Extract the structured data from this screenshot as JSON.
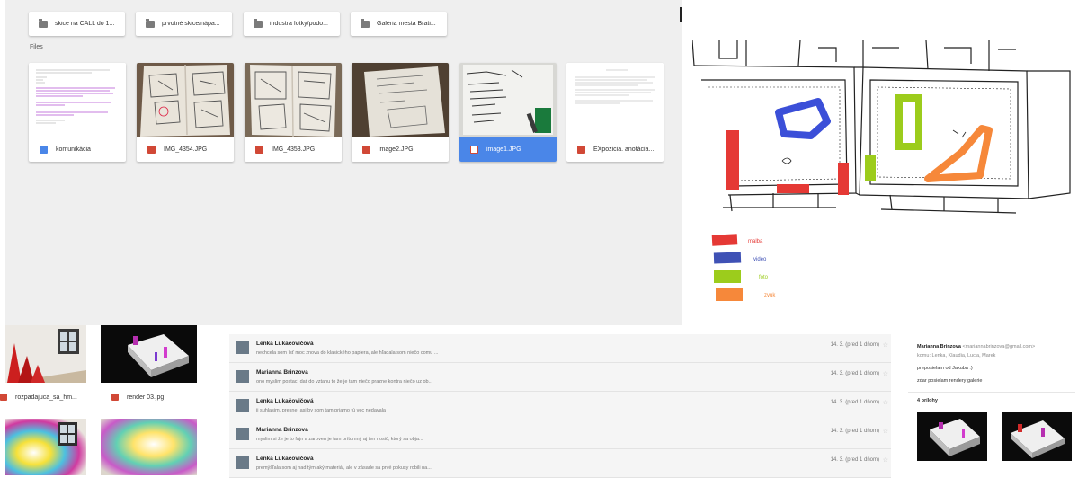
{
  "drive": {
    "folders": [
      {
        "label": "skice na CALL do 1..."
      },
      {
        "label": "prvotné skice/nápa..."
      },
      {
        "label": "industra fotky/podo..."
      },
      {
        "label": "Galéria mesta Brati..."
      }
    ],
    "files_label": "Files",
    "files": [
      {
        "name": "komunikácia",
        "type": "doc",
        "selected": false
      },
      {
        "name": "IMG_4354.JPG",
        "type": "img",
        "selected": false
      },
      {
        "name": "IMG_4353.JPG",
        "type": "img",
        "selected": false
      },
      {
        "name": "image2.JPG",
        "type": "img",
        "selected": false
      },
      {
        "name": "image1.JPG",
        "type": "img",
        "selected": true
      },
      {
        "name": "EXpozicia. anotácia...",
        "type": "pdf",
        "selected": false
      }
    ]
  },
  "floorplan": {
    "legend": [
      {
        "label": "malba",
        "color": "#e53935"
      },
      {
        "label": "video",
        "color": "#3f51b5"
      },
      {
        "label": "foto",
        "color": "#9ccc1c"
      },
      {
        "label": "zvuk",
        "color": "#f6883a"
      }
    ]
  },
  "renders": {
    "captions": [
      "rozpadajuca_sa_hm...",
      "render 03.jpg"
    ]
  },
  "emails": [
    {
      "sender": "Lenka Lukačovičová",
      "snippet": "nechcela som ísť moc znova do klasického papiera, ale hľadala som niečo comu ...",
      "date": "14. 3. (pred 1 dňom)"
    },
    {
      "sender": "Marianna Brinzova",
      "snippet": "ono myslim postací dať do vztahu to že je tam niečo prazne kontra niečo uz ob...",
      "date": "14. 3. (pred 1 dňom)"
    },
    {
      "sender": "Lenka Lukačovičová",
      "snippet": "jj suhlasim, presne, asi by som tam priamo tú vec nedavala",
      "date": "14. 3. (pred 1 dňom)"
    },
    {
      "sender": "Marianna Brinzova",
      "snippet": "myslim si že je to fajn a zaroven je tam prítomný aj ten nosič, ktorý sa obja...",
      "date": "14. 3. (pred 1 dňom)"
    },
    {
      "sender": "Lenka Lukačovičová",
      "snippet": "premýšľala som aj nad tým aký materiál, ale v zásade sa prvé pokusy robili na...",
      "date": "14. 3. (pred 1 dňom)"
    }
  ],
  "detail": {
    "from_name": "Marianna Brinzova",
    "from_email": "<mariannabrinzova@gmail.com>",
    "to": "komu: Lenka, Klaudia, Lucia, Marek",
    "line1": "preposielam od Jakuba :)",
    "line2": "zdar posielam rendery galerie",
    "attachments": "4 prílohy"
  }
}
